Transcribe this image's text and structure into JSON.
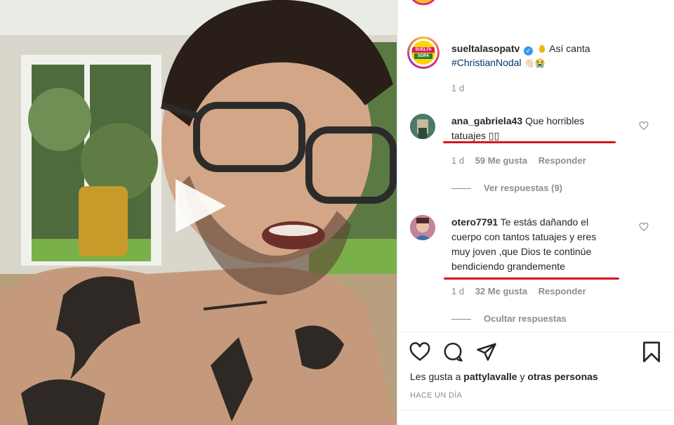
{
  "post": {
    "username": "sueltalasopatv",
    "caption_text": "Así canta",
    "hashtag": "#ChristianNodal",
    "caption_emojis": "👋🏻😭",
    "age": "1 d",
    "logo_line1": "SUELTA",
    "logo_line2": "SOPA"
  },
  "comments": [
    {
      "username": "ana_gabriela43",
      "text_line1": "Que horribles",
      "text_line2": "tatuajes ▯▯",
      "age": "1 d",
      "likes": "59 Me gusta",
      "reply": "Responder",
      "replies_toggle": "Ver respuestas (9)",
      "avatar_color": "#3f6a5a"
    },
    {
      "username": "otero7791",
      "text_line1": "Te estás dañando el",
      "text_line2": "cuerpo con tantos tatuajes y eres",
      "text_line3": "muy joven ,que Dios te continúe",
      "text_line4": "bendiciendo grandemente",
      "age": "1 d",
      "likes": "32 Me gusta",
      "reply": "Responder",
      "replies_toggle": "Ocultar respuestas",
      "avatar_color": "#a35a6e"
    }
  ],
  "footer": {
    "likes_prefix": "Les gusta a",
    "likes_user": "pattylavalle",
    "likes_joiner": "y",
    "likes_others": "otras personas",
    "timestamp": "HACE UN DÍA"
  },
  "colors": {
    "underline": "#d8151f",
    "link": "#00376b",
    "muted": "#8e8e8e"
  }
}
